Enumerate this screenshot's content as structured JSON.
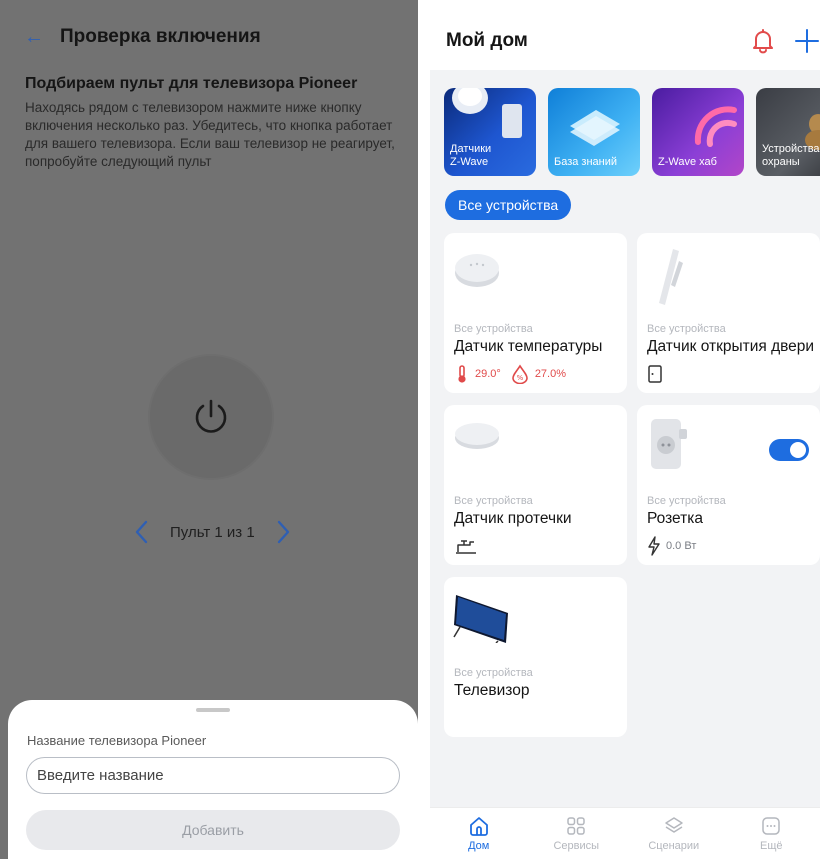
{
  "left": {
    "header": {
      "back_icon": "arrow-left-icon",
      "title": "Проверка включения"
    },
    "subtitle": "Подбираем пульт для телевизора Pioneer",
    "description": "Находясь рядом с телевизором нажмите ниже кнопку включения несколько раз. Убедитесь, что кнопка работает для вашего телевизора. Если ваш телевизор не реагирует, попробуйте следующий пульт",
    "power_icon": "power-icon",
    "remote_nav": {
      "label": "Пульт 1 из 1",
      "prev_icon": "chevron-left-icon",
      "next_icon": "chevron-right-icon"
    },
    "sheet": {
      "label": "Название телевизора Pioneer",
      "input_placeholder": "Введите название",
      "input_value": "",
      "button": "Добавить"
    }
  },
  "right": {
    "header": {
      "title": "Мой дом",
      "bell_icon": "bell-icon",
      "add_icon": "plus-icon"
    },
    "banners": [
      {
        "label": "Датчики\nZ-Wave"
      },
      {
        "label": "База знаний"
      },
      {
        "label": "Z-Wave хаб"
      },
      {
        "label": "Устройства\nохраны"
      }
    ],
    "filter_chip": "Все устройства",
    "devices": [
      {
        "room": "Все устройства",
        "name": "Датчик температуры",
        "temperature": "29.0°",
        "humidity": "27.0%"
      },
      {
        "room": "Все устройства",
        "name": "Датчик открытия двери",
        "status_icon": "door-closed-icon"
      },
      {
        "room": "Все устройства",
        "name": "Датчик протечки",
        "status_icon": "faucet-icon"
      },
      {
        "room": "Все устройства",
        "name": "Розетка",
        "power": "0.0 Вт",
        "switch_on": true
      },
      {
        "room": "Все устройства",
        "name": "Телевизор"
      }
    ],
    "tabs": [
      {
        "label": "Дом",
        "icon": "home-icon",
        "active": true
      },
      {
        "label": "Сервисы",
        "icon": "grid-icon",
        "active": false
      },
      {
        "label": "Сценарии",
        "icon": "layers-icon",
        "active": false
      },
      {
        "label": "Ещё",
        "icon": "more-icon",
        "active": false
      }
    ],
    "colors": {
      "accent": "#1e6de0",
      "warning": "#e04a4a"
    }
  }
}
